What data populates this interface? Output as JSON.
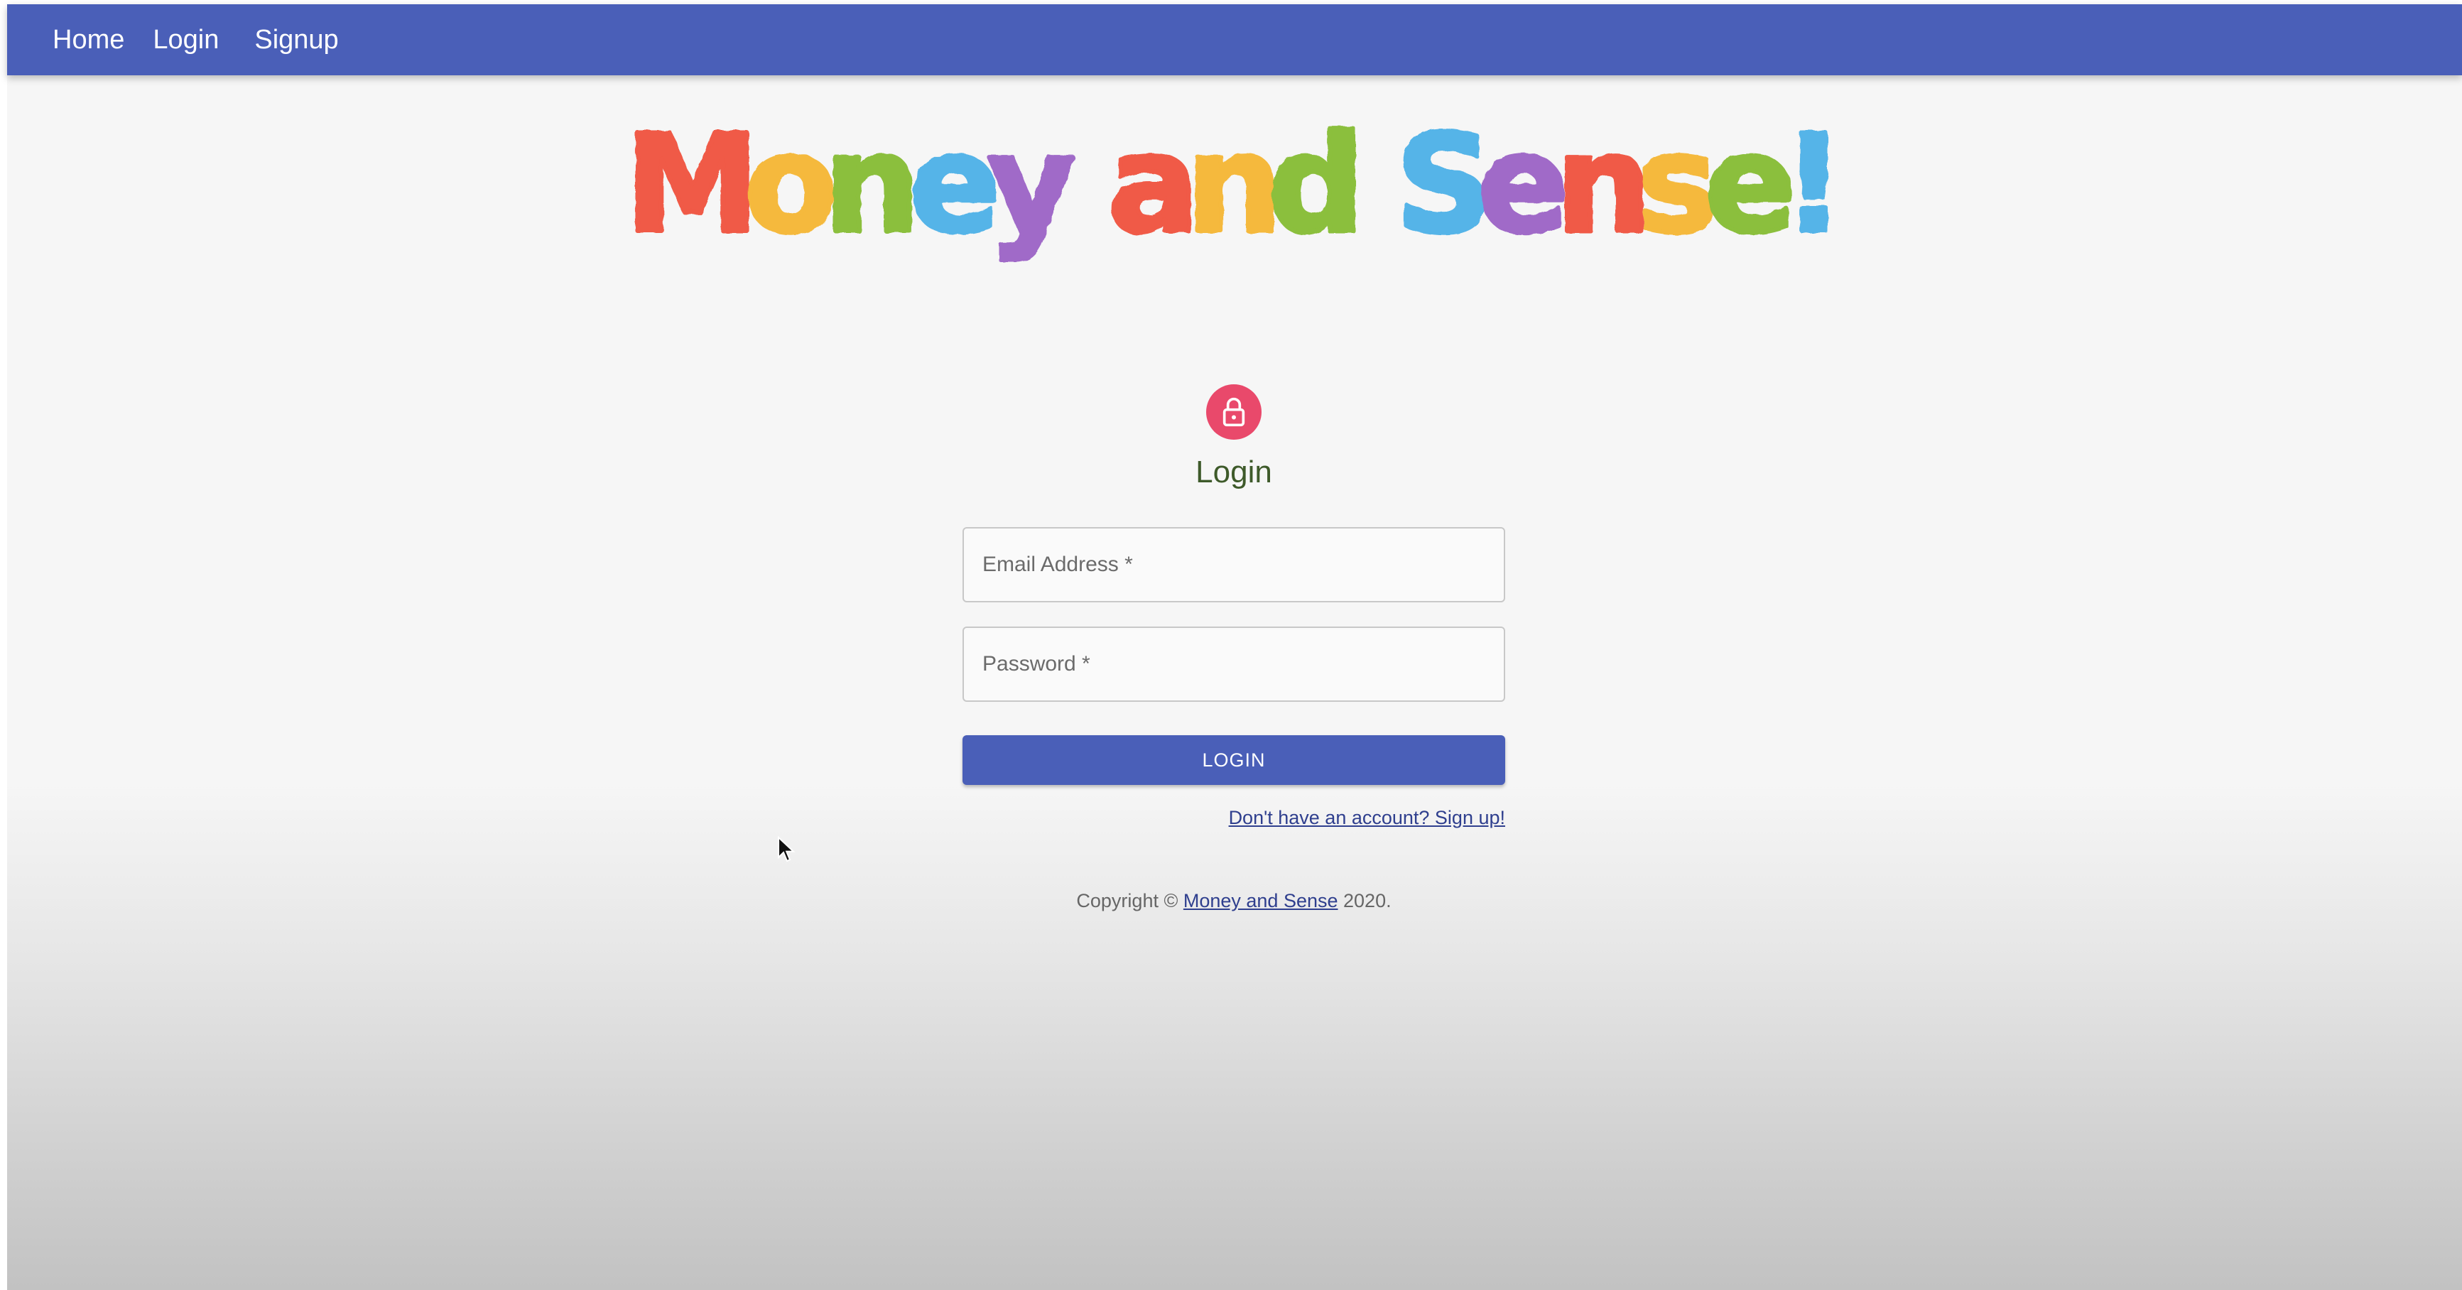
{
  "navbar": {
    "home_label": "Home",
    "login_label": "Login",
    "signup_label": "Signup"
  },
  "logo": {
    "text": "Money and Sense!",
    "letter_colors": [
      "#f05a46",
      "#f5b93c",
      "#8bbf3c",
      "#55b4e8",
      "#a06ac8",
      "#f05a46",
      "#f5b93c",
      "#8bbf3c",
      "#55b4e8",
      "#a06ac8",
      "#f05a46",
      "#f5b93c",
      "#8bbf3c",
      "#55b4e8"
    ]
  },
  "login_form": {
    "lock_icon": "lock-icon",
    "title": "Login",
    "email_placeholder": "Email Address *",
    "password_placeholder": "Password *",
    "submit_label": "LOGIN",
    "signup_link": "Don't have an account? Sign up!"
  },
  "footer": {
    "copyright_prefix": "Copyright © ",
    "brand_link": "Money and Sense",
    "copyright_suffix": " 2020."
  },
  "colors": {
    "navbar": "#4a5fb8",
    "lock_avatar": "#e9496b",
    "title": "#3e5a2a",
    "link": "#2f3f8e"
  }
}
